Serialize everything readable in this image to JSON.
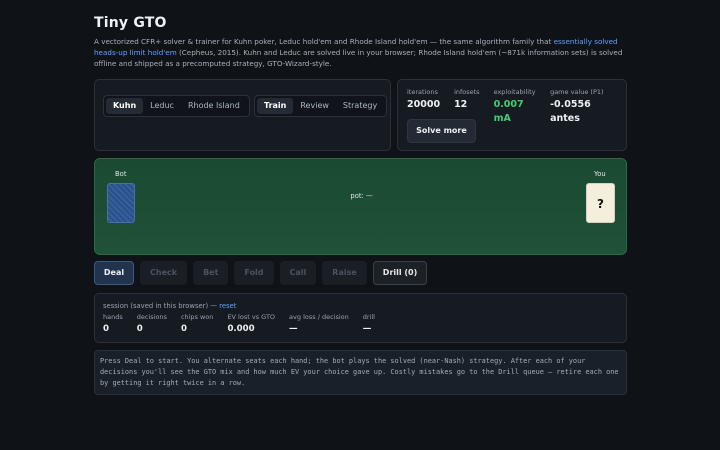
{
  "header": {
    "title": "Tiny GTO",
    "intro_before": "A vectorized CFR+ solver & trainer for Kuhn poker, Leduc hold'em and Rhode Island hold'em — the same algorithm family that ",
    "intro_link": "essentially solved heads-up limit hold'em",
    "intro_after": " (Cepheus, 2015). Kuhn and Leduc are solved live in your browser; Rhode Island hold'em (~871k information sets) is solved offline and shipped as a precomputed strategy, GTO-Wizard-style."
  },
  "games": [
    {
      "label": "Kuhn",
      "active": true
    },
    {
      "label": "Leduc",
      "active": false
    },
    {
      "label": "Rhode Island",
      "active": false
    }
  ],
  "modes": [
    {
      "label": "Train",
      "active": true
    },
    {
      "label": "Review",
      "active": false
    },
    {
      "label": "Strategy",
      "active": false
    }
  ],
  "solver_stats": [
    {
      "label": "iterations",
      "value": "20000",
      "color": "#eef1f5"
    },
    {
      "label": "infosets",
      "value": "12",
      "color": "#eef1f5"
    },
    {
      "label": "exploitability",
      "value": "0.007 mA",
      "color": "#3fce75"
    },
    {
      "label": "game value (P1)",
      "value": "-0.0556 antes",
      "color": "#eef1f5"
    }
  ],
  "solve_more_label": "Solve more",
  "table": {
    "bot_label": "Bot",
    "you_label": "You",
    "pot_label": "pot:",
    "pot_value": "—",
    "your_card": "?"
  },
  "actions": {
    "deal": "Deal",
    "check": "Check",
    "bet": "Bet",
    "fold": "Fold",
    "call": "Call",
    "raise": "Raise",
    "drill": "Drill (0)"
  },
  "session": {
    "heading": "session (saved in this browser) — ",
    "reset_label": "reset",
    "stats": [
      {
        "label": "hands",
        "value": "0"
      },
      {
        "label": "decisions",
        "value": "0"
      },
      {
        "label": "chips won",
        "value": "0"
      },
      {
        "label": "EV lost vs GTO",
        "value": "0.000"
      },
      {
        "label": "avg loss / decision",
        "value": "—"
      },
      {
        "label": "drill",
        "value": "—"
      }
    ]
  },
  "log_text": "Press Deal to start. You alternate seats each hand; the bot plays the solved (near-Nash) strategy. After each of your decisions you'll see the GTO mix and how much EV your choice gave up. Costly mistakes go to the Drill queue — retire each one by getting it right twice in a row.",
  "colors": {
    "background": "#0f1217",
    "felt": "#1f5236",
    "accent_link": "#5fa3ff",
    "positive": "#3fce75"
  }
}
